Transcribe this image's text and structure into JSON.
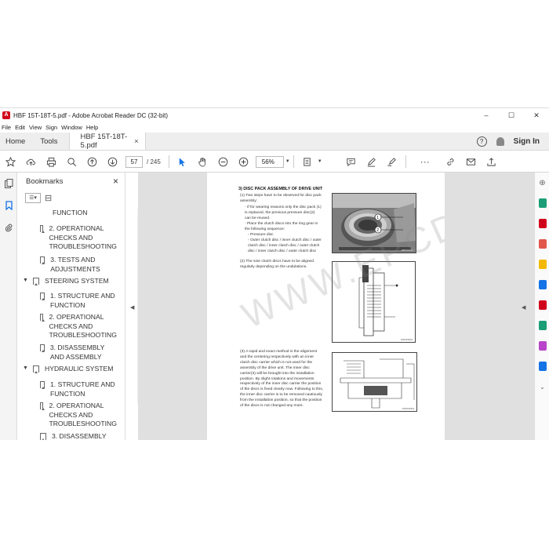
{
  "window": {
    "title": "HBF 15T-18T-5.pdf - Adobe Acrobat Reader DC (32-bit)",
    "controls": {
      "minimize": "–",
      "maximize": "☐",
      "close": "✕"
    }
  },
  "menu": [
    "File",
    "Edit",
    "View",
    "Sign",
    "Window",
    "Help"
  ],
  "tabs": {
    "home": "Home",
    "tools": "Tools",
    "document": "HBF 15T-18T-5.pdf",
    "close": "×",
    "help_icon": "?",
    "sign_in": "Sign In"
  },
  "toolbar": {
    "current_page": "57",
    "total_pages": "/ 245",
    "zoom": "56%",
    "more": "···"
  },
  "bookmarks": {
    "title": "Bookmarks",
    "close": "×",
    "items": [
      {
        "label": "FUNCTION",
        "type": "child"
      },
      {
        "label": "2. OPERATIONAL CHECKS AND TROUBLESHOOTING",
        "type": "child"
      },
      {
        "label": "3. TESTS AND ADJUSTMENTS",
        "type": "child"
      },
      {
        "label": "STEERING SYSTEM",
        "type": "parent"
      },
      {
        "label": "1. STRUCTURE AND FUNCTION",
        "type": "child"
      },
      {
        "label": "2. OPERATIONAL CHECKS AND TROUBLESHOOTING",
        "type": "child"
      },
      {
        "label": "3. DISASSEMBLY AND ASSEMBLY",
        "type": "child"
      },
      {
        "label": "HYDRAULIC SYSTEM",
        "type": "parent"
      },
      {
        "label": "1. STRUCTURE AND FUNCTION",
        "type": "child"
      },
      {
        "label": "2. OPERATIONAL CHECKS AND TROUBLESHOOTING",
        "type": "child"
      },
      {
        "label": "3. DISASSEMBLY",
        "type": "child"
      }
    ]
  },
  "page": {
    "heading": "3) DISC PACK ASSEMBLY OF DRIVE UNIT",
    "para1": "(1) Two steps have to be observed for disc pack assembly:",
    "bullets1": [
      "· If for wearing reasons only the disc pack (1) is replaced, the previous pressure disc(2) can be reused.",
      "· Place the clutch discs into the ring gear in the following sequence:",
      "- Pressure disc",
      "- Outer clutch disc / inner clutch disc / outer clutch disc / inner clutch disc / outer clutch disc / inner clutch disc / outer clutch disc"
    ],
    "fig1_caption": "D507AAO1",
    "para2": "(2) The sine clutch discs have to be aligned regularly depending on the undulations.",
    "fig2_caption": "D507DD02",
    "para3": "(3) A rapid and exact method is the alignment and the centering respectively with an inner clutch disc carrier which is not used for the assembly of the drive unit. The inner disc carrier(3) will be brought into the installation position. By slight rotations and movements respectively of the inner disc carrier the position of the discs is fixed clearly now. Following to this, the inner disc carrier is to be removed cautiously from the installation position, so that the position of the discs is not changed any more.",
    "fig3_caption": "D507DD03",
    "callout1": "1",
    "callout2": "2"
  },
  "watermark": "WWW.EPCDEPO.COM",
  "colors": {
    "accent": "#1473e6",
    "acrobat_red": "#d0021b"
  },
  "right_rail_icons": [
    {
      "name": "zoom-in-icon",
      "color": "#666"
    },
    {
      "name": "export-pdf-icon",
      "color": "#1b9e77"
    },
    {
      "name": "organize-pages-icon",
      "color": "#d0021b"
    },
    {
      "name": "create-pdf-icon",
      "color": "#d0021b"
    },
    {
      "name": "comment-icon",
      "color": "#f5b800"
    },
    {
      "name": "combine-files-icon",
      "color": "#1473e6"
    },
    {
      "name": "edit-pdf-icon",
      "color": "#d0021b"
    },
    {
      "name": "enhance-scans-icon",
      "color": "#1b9e77"
    },
    {
      "name": "fill-sign-icon",
      "color": "#b845c9"
    },
    {
      "name": "protect-icon",
      "color": "#1473e6"
    },
    {
      "name": "more-tools-icon",
      "color": "#666"
    }
  ]
}
